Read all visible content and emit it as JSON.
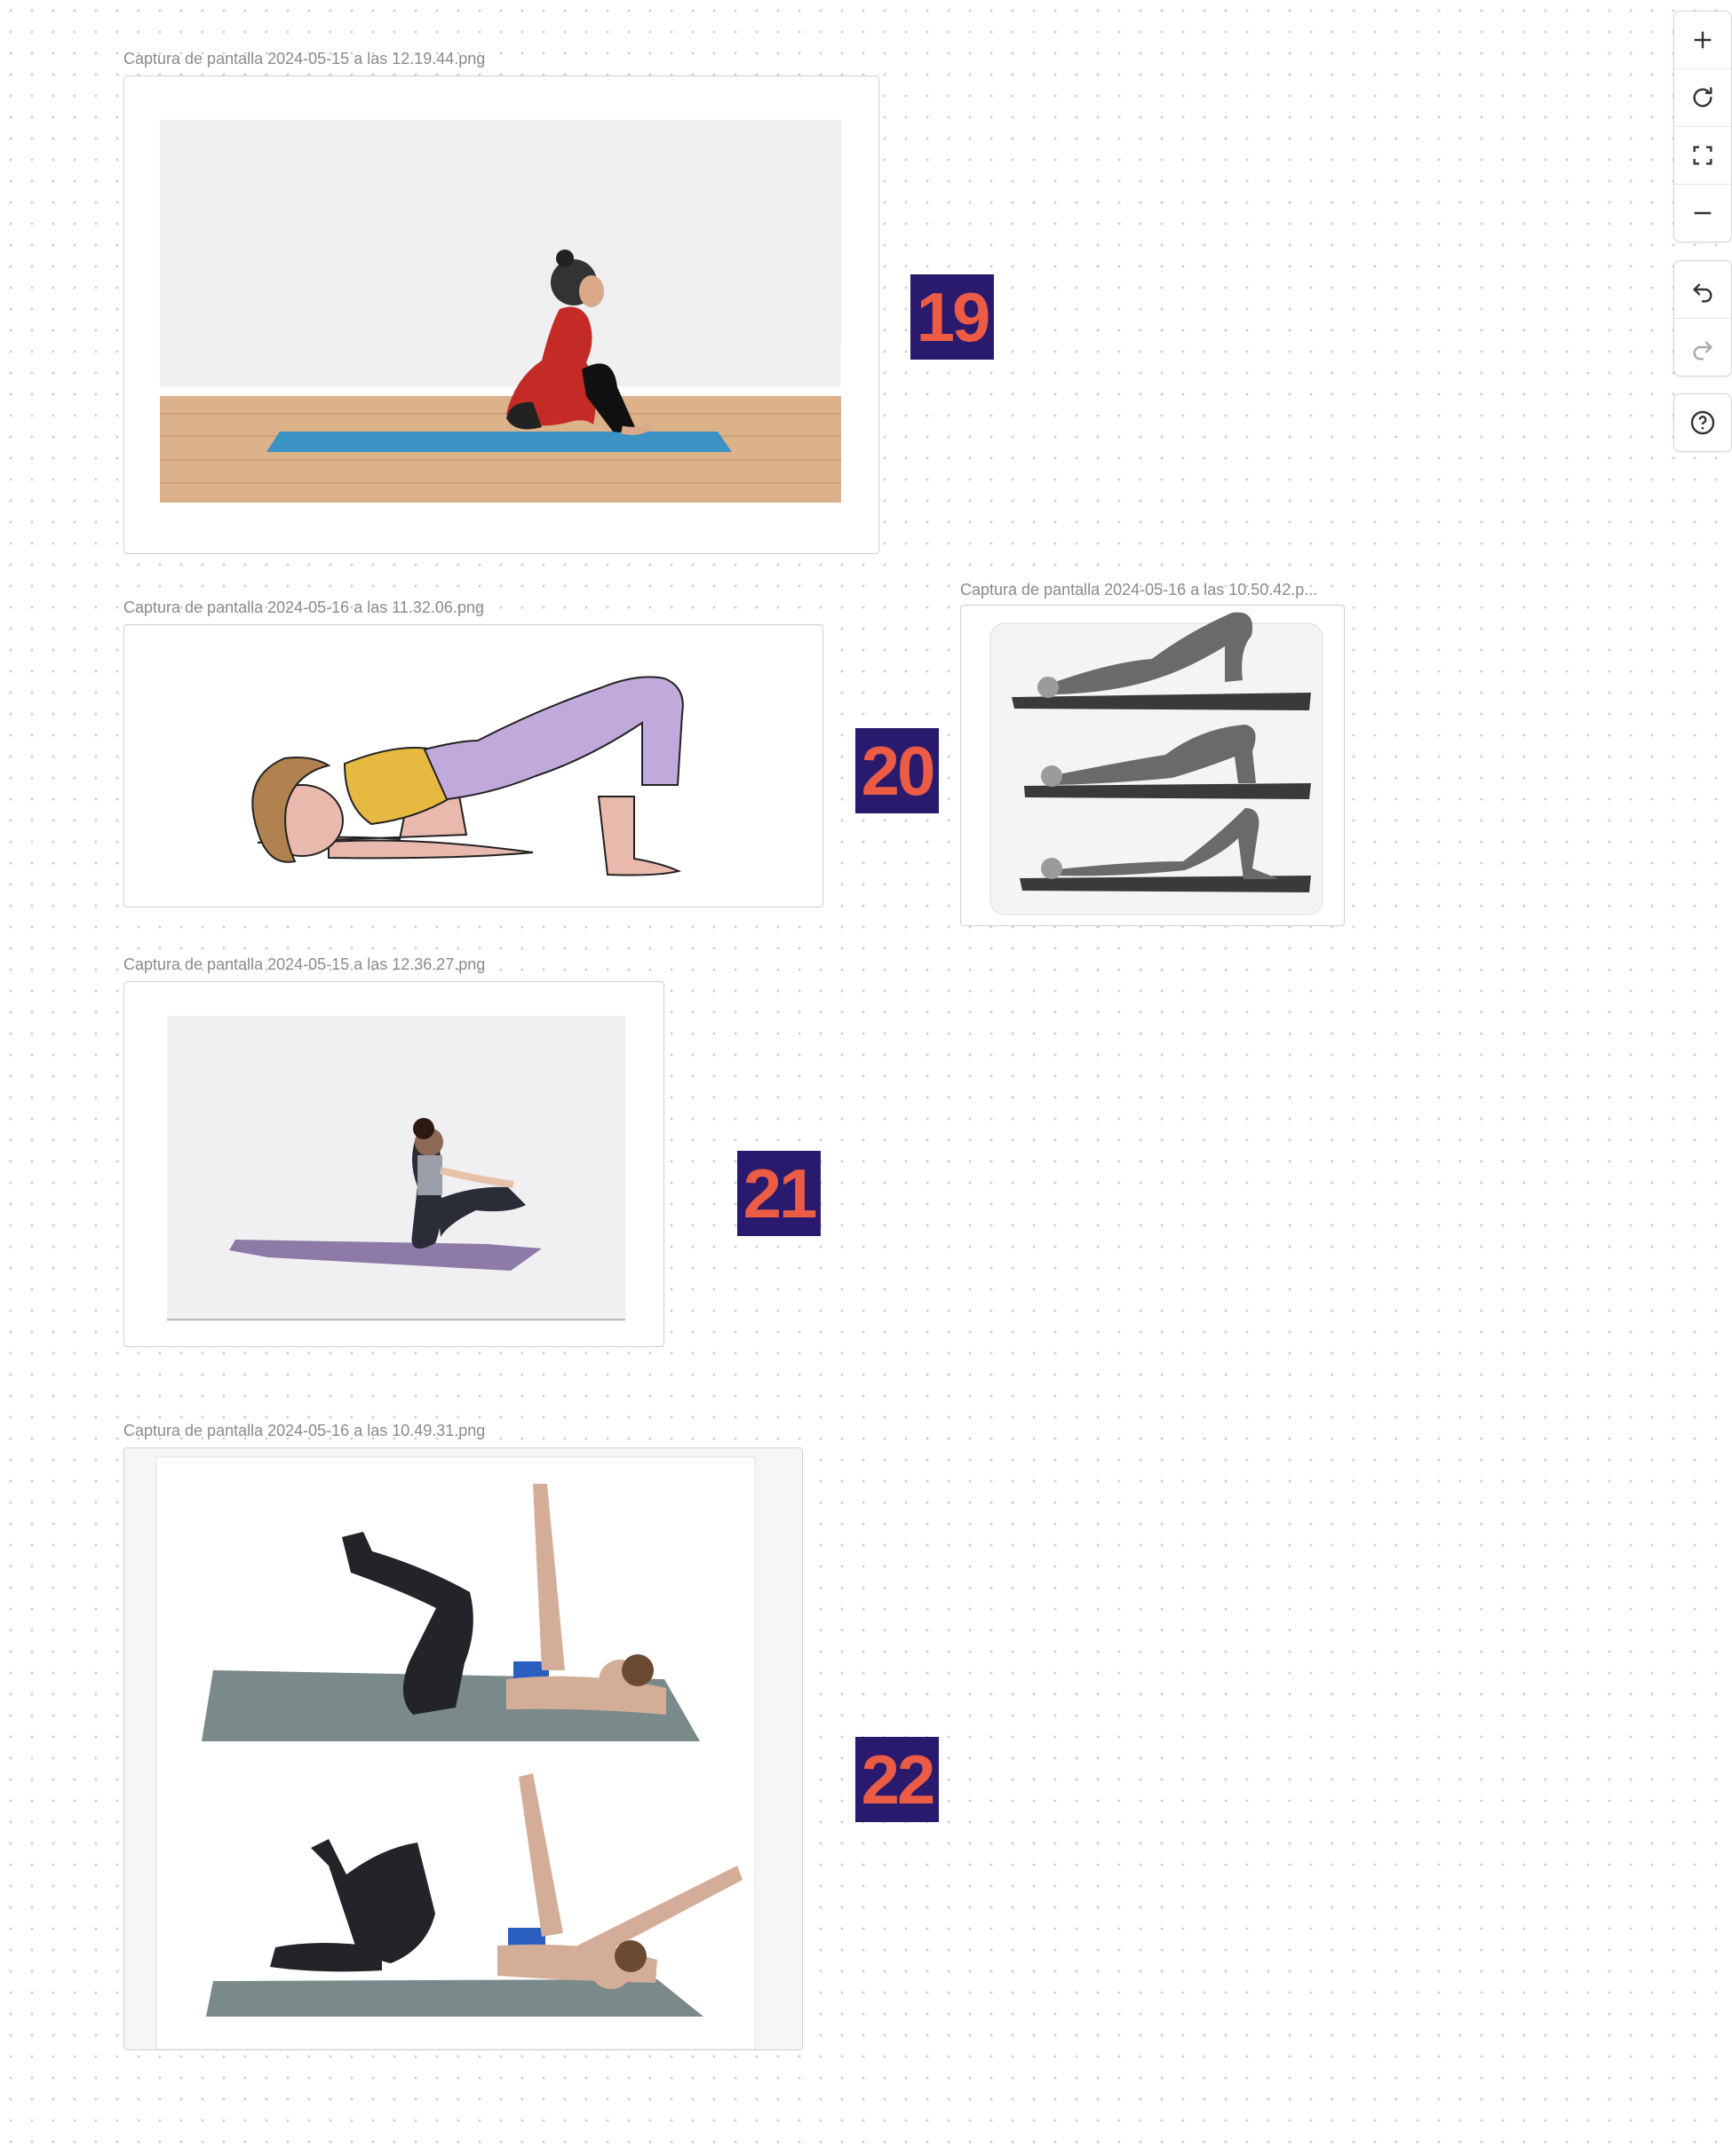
{
  "cards": [
    {
      "caption": "Captura de pantalla 2024-05-15 a las 12.19.44.png",
      "badge": "19"
    },
    {
      "caption": "Captura de pantalla 2024-05-16 a las 11.32.06.png",
      "badge": "20"
    },
    {
      "caption": "Captura de pantalla 2024-05-16 a las 10.50.42.p...",
      "badge": ""
    },
    {
      "caption": "Captura de pantalla 2024-05-15 a las 12.36.27.png",
      "badge": "21"
    },
    {
      "caption": "Captura de pantalla 2024-05-16 a las 10.49.31.png",
      "badge": "22"
    }
  ],
  "toolbar": {
    "group1": [
      "plus-icon",
      "refresh-icon",
      "fullscreen-icon",
      "minus-icon"
    ],
    "group2": [
      "undo-icon",
      "redo-icon"
    ],
    "group3": [
      "help-icon"
    ]
  },
  "colors": {
    "badge_bg": "#2a1a6e",
    "badge_text": "#ec5b43"
  }
}
